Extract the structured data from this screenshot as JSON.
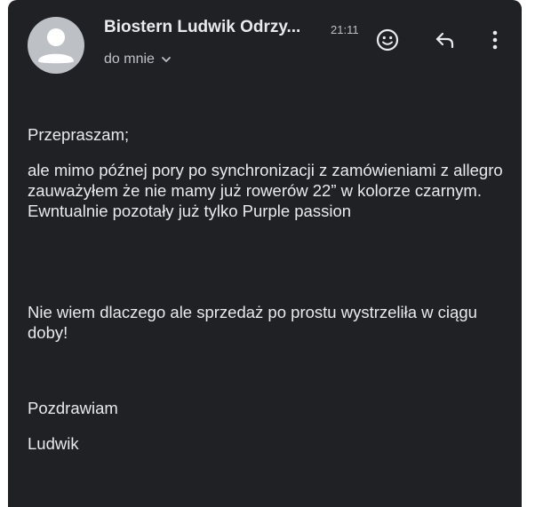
{
  "email": {
    "sender_name": "Biostern Ludwik Odrzy...",
    "time": "21:11",
    "recipient_label": "do mnie",
    "icons": {
      "avatar": "person-avatar-icon",
      "recipient_details": "chevron-down-icon",
      "emoji": "smiley-icon",
      "reply": "reply-arrow-icon",
      "more": "more-vert-icon"
    },
    "body": {
      "greeting": "Przepraszam;",
      "message": "ale mimo późnej pory po synchronizacji z zamówieniami z allegro zauważyłem że nie mamy już rowerów 22” w kolorze czarnym. Ewntualnie pozotały już tylko Purple passion",
      "note": "Nie wiem dlaczego ale sprzedaż po prostu wystrzeliła w ciągu doby!",
      "regards": "Pozdrawiam",
      "signature": "Ludwik"
    }
  },
  "colors": {
    "card_background": "#202124",
    "page_background": "#ffffff",
    "primary_text": "#e8eaed",
    "secondary_text": "#bdc1c6",
    "avatar_background": "#bdc1c6"
  }
}
